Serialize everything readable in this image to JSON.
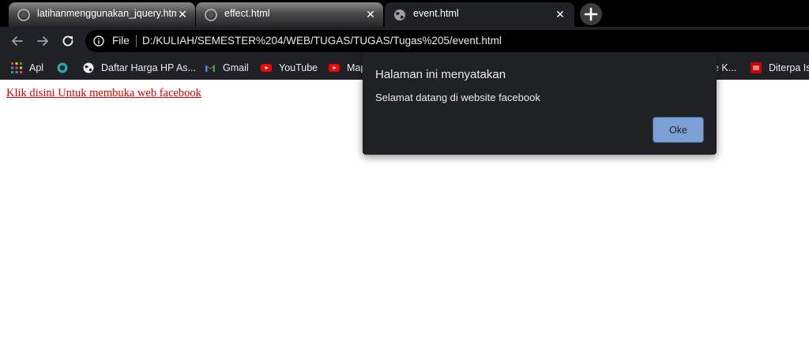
{
  "tabs": [
    {
      "title": "latihanmenggunakan_jquery.html",
      "close": "✕"
    },
    {
      "title": "effect.html",
      "close": "✕"
    },
    {
      "title": "event.html",
      "close": "✕"
    }
  ],
  "omnibox": {
    "scheme_label": "File",
    "url": "D:/KULIAH/SEMESTER%204/WEB/TUGAS/TUGAS/Tugas%205/event.html"
  },
  "bookmarks": [
    {
      "label": "Apl"
    },
    {
      "label": ""
    },
    {
      "label": "Daftar Harga HP As..."
    },
    {
      "label": "Gmail"
    },
    {
      "label": "YouTube"
    },
    {
      "label": "Map"
    },
    {
      "label": "e K..."
    },
    {
      "label": "Diterpa Is"
    }
  ],
  "page": {
    "link_text": "Klik disini Untuk membuka web facebook"
  },
  "dialog": {
    "title": "Halaman ini menyatakan",
    "message": "Selamat datang di website facebook",
    "ok_label": "Oke"
  },
  "colors": {
    "link": "#e00000",
    "dialog_button": "#7ca0d6",
    "toolbar": "#202124"
  }
}
